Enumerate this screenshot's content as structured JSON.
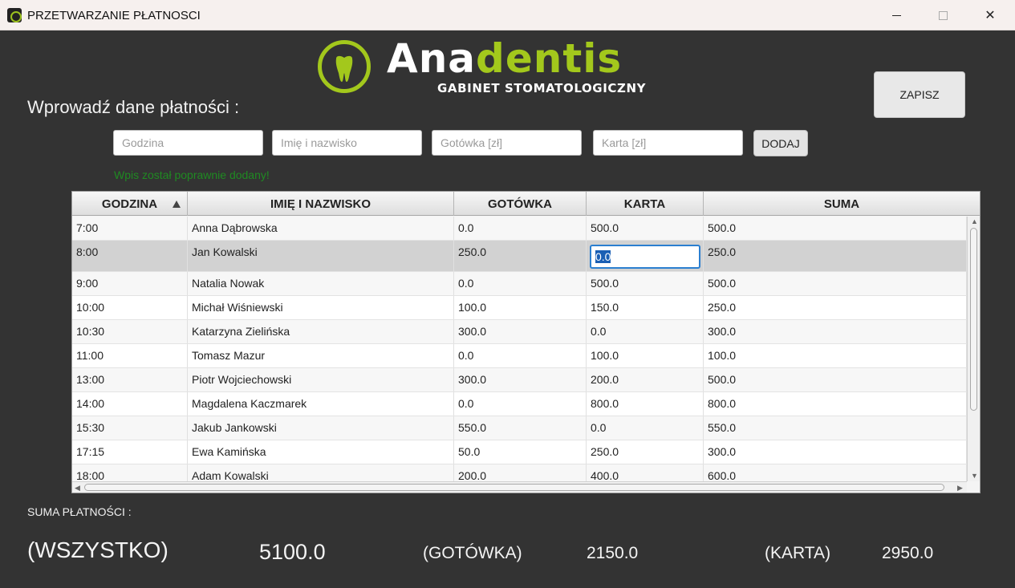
{
  "window": {
    "title": "PRZETWARZANIE PŁATNOSCI",
    "minimize": "—",
    "close": "✕"
  },
  "logo": {
    "word_a": "Ana",
    "word_b": "dentis",
    "subtitle": "GABINET STOMATOLOGICZNY",
    "accent_color": "#a3c81c"
  },
  "toolbar": {
    "save_label": "ZAPISZ",
    "add_label": "DODAJ"
  },
  "form": {
    "heading": "Wprowadź dane płatności :",
    "hour_placeholder": "Godzina",
    "name_placeholder": "Imię i nazwisko",
    "cash_placeholder": "Gotówka [zł]",
    "card_placeholder": "Karta [zł]",
    "status_message": "Wpis został poprawnie dodany!",
    "status_color": "#1f8a22"
  },
  "table": {
    "columns": [
      "GODZINA",
      "IMIĘ I NAZWISKO",
      "GOTÓWKA",
      "KARTA",
      "SUMA"
    ],
    "sorted_column": "GODZINA",
    "sort_direction": "ascending",
    "rows": [
      [
        "7:00",
        "Anna Dąbrowska",
        "0.0",
        "500.0",
        "500.0"
      ],
      [
        "8:00",
        "Jan Kowalski",
        "250.0",
        "0.0",
        "250.0"
      ],
      [
        "9:00",
        "Natalia Nowak",
        "0.0",
        "500.0",
        "500.0"
      ],
      [
        "10:00",
        "Michał Wiśniewski",
        "100.0",
        "150.0",
        "250.0"
      ],
      [
        "10:30",
        "Katarzyna Zielińska",
        "300.0",
        "0.0",
        "300.0"
      ],
      [
        "11:00",
        "Tomasz Mazur",
        "0.0",
        "100.0",
        "100.0"
      ],
      [
        "13:00",
        "Piotr Wojciechowski",
        "300.0",
        "200.0",
        "500.0"
      ],
      [
        "14:00",
        "Magdalena Kaczmarek",
        "0.0",
        "800.0",
        "800.0"
      ],
      [
        "15:30",
        "Jakub Jankowski",
        "550.0",
        "0.0",
        "550.0"
      ],
      [
        "17:15",
        "Ewa Kamińska",
        "50.0",
        "250.0",
        "300.0"
      ],
      [
        "18:00",
        "Adam Kowalski",
        "200.0",
        "400.0",
        "600.0"
      ]
    ],
    "editing": {
      "row": 1,
      "column": "KARTA",
      "value": "0.0"
    }
  },
  "summary": {
    "label": "SUMA PŁATNOŚCI :",
    "all_label": "(WSZYSTKO)",
    "all_value": "5100.0",
    "cash_label": "(GOTÓWKA)",
    "cash_value": "2150.0",
    "card_label": "(KARTA)",
    "card_value": "2950.0"
  }
}
